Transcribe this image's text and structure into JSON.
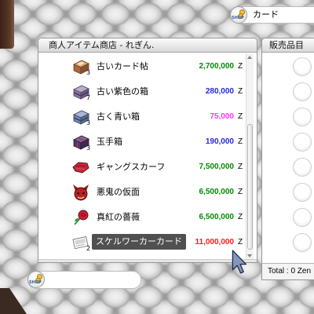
{
  "shop_signs": {
    "top": {
      "label": "カード",
      "icon": "shop-icon",
      "icon_text": "SHOP"
    },
    "bottom": {
      "icon": "shop-icon",
      "icon_text": "SHOP"
    }
  },
  "vendor_window": {
    "title": "商人アイテム商店 - れぎん.",
    "currency": "Z",
    "items": [
      {
        "name": "古いカード帖",
        "count": "3",
        "price": "2,700,000",
        "price_color": "#008a00",
        "icon": "old-card-album-icon"
      },
      {
        "name": "古い紫色の箱",
        "count": "7",
        "price": "280,000",
        "price_color": "#2626d9",
        "icon": "old-purple-box-icon"
      },
      {
        "name": "古く青い箱",
        "count": "3",
        "price": "75,000",
        "price_color": "#ff33ff",
        "icon": "old-blue-box-icon"
      },
      {
        "name": "玉手箱",
        "count": "3",
        "price": "190,000",
        "price_color": "#2626d9",
        "icon": "treasure-box-icon"
      },
      {
        "name": "ギャングスカーフ",
        "price": "7,500,000",
        "price_color": "#008a00",
        "icon": "gang-scarf-icon"
      },
      {
        "name": "悪鬼の仮面",
        "price": "6,500,000",
        "price_color": "#008a00",
        "icon": "evil-mask-icon"
      },
      {
        "name": "真紅の薔薇",
        "price": "6,500,000",
        "price_color": "#008a00",
        "icon": "crimson-rose-icon"
      },
      {
        "name": "スケルワーカーカード",
        "count": "2",
        "price": "11,000,000",
        "price_color": "#ff1a1a",
        "icon": "card-icon"
      }
    ]
  },
  "purchase_window": {
    "title": "販売品目",
    "total": "Total : 0 Zen"
  }
}
